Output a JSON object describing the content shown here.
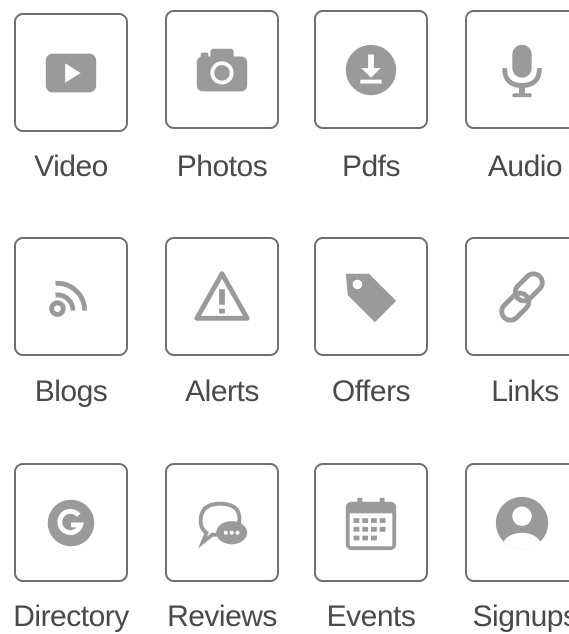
{
  "icon_color": "#9a9a9a",
  "border_color": "#6f6f6f",
  "label_color": "#4a4a4a",
  "tiles": [
    {
      "label": "Video",
      "icon": "video-play-icon"
    },
    {
      "label": "Photos",
      "icon": "camera-icon"
    },
    {
      "label": "Pdfs",
      "icon": "download-icon"
    },
    {
      "label": "Audio",
      "icon": "microphone-icon"
    },
    {
      "label": "Blogs",
      "icon": "rss-feed-icon"
    },
    {
      "label": "Alerts",
      "icon": "warning-triangle-icon"
    },
    {
      "label": "Offers",
      "icon": "price-tag-icon"
    },
    {
      "label": "Links",
      "icon": "chain-link-icon"
    },
    {
      "label": "Directory",
      "icon": "google-g-icon"
    },
    {
      "label": "Reviews",
      "icon": "chat-bubbles-icon"
    },
    {
      "label": "Events",
      "icon": "calendar-icon"
    },
    {
      "label": "Signups",
      "icon": "user-avatar-icon"
    }
  ]
}
